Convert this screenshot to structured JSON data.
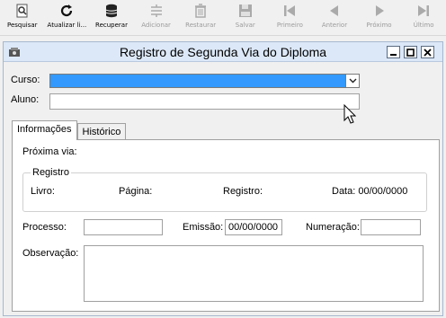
{
  "toolbar": {
    "items": [
      {
        "label": "Pesquisar",
        "icon": "search-doc-icon",
        "enabled": true
      },
      {
        "label": "Atualizar li...",
        "icon": "refresh-icon",
        "enabled": true
      },
      {
        "label": "Recuperar",
        "icon": "database-icon",
        "enabled": true
      },
      {
        "label": "Adicionar",
        "icon": "add-icon",
        "enabled": false
      },
      {
        "label": "Restaurar",
        "icon": "trash-icon",
        "enabled": false
      },
      {
        "label": "Salvar",
        "icon": "save-icon",
        "enabled": false
      },
      {
        "label": "Primeiro",
        "icon": "first-icon",
        "enabled": false
      },
      {
        "label": "Anterior",
        "icon": "previous-icon",
        "enabled": false
      },
      {
        "label": "Próximo",
        "icon": "next-icon",
        "enabled": false
      },
      {
        "label": "Último",
        "icon": "last-icon",
        "enabled": false
      }
    ]
  },
  "window": {
    "title": "Registro de Segunda Via do Diploma"
  },
  "form": {
    "curso_label": "Curso:",
    "curso_value": "",
    "aluno_label": "Aluno:",
    "aluno_value": ""
  },
  "tabs": [
    {
      "label": "Informações",
      "active": true
    },
    {
      "label": "Histórico",
      "active": false
    }
  ],
  "info": {
    "proxima_via_label": "Próxima via:",
    "registro_group": "Registro",
    "livro_label": "Livro:",
    "pagina_label": "Página:",
    "registro_label": "Registro:",
    "data_label": "Data: 00/00/0000",
    "processo_label": "Processo:",
    "processo_value": "",
    "emissao_label": "Emissão:",
    "emissao_value": "00/00/0000",
    "numeracao_label": "Numeração:",
    "numeracao_value": "",
    "observacao_label": "Observação:",
    "observacao_value": ""
  },
  "colors": {
    "selection": "#3399ff",
    "titlebar": "#dce8f7",
    "background": "#f0f0f0"
  }
}
